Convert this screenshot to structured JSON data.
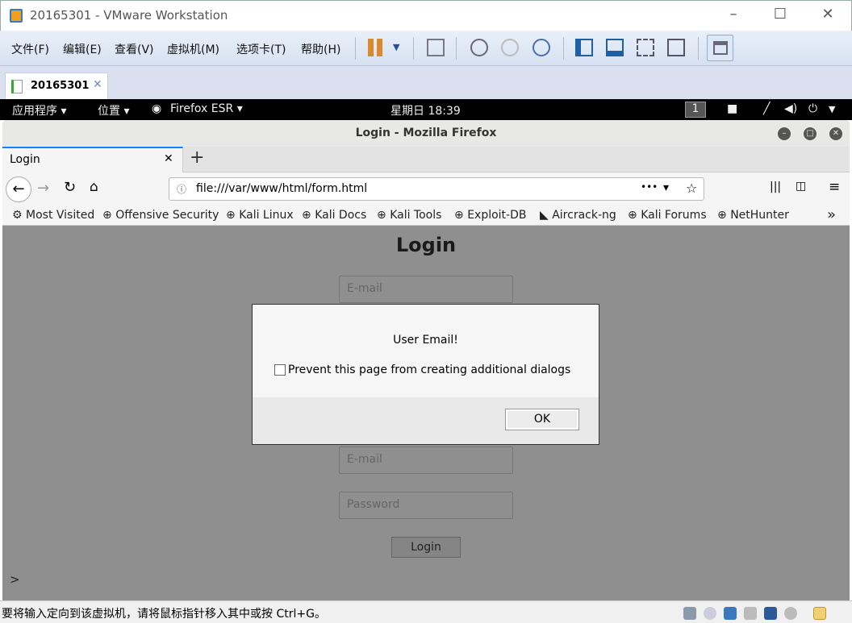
{
  "window": {
    "title": "20165301 - VMware Workstation",
    "minimize": "–",
    "maximize": "☐",
    "close": "✕"
  },
  "menu": [
    "文件(F)",
    "编辑(E)",
    "查看(V)",
    "虚拟机(M)",
    "选项卡(T)",
    "帮助(H)"
  ],
  "vm_tab": {
    "label": "20165301",
    "close": "✕"
  },
  "kali_panel": {
    "apps": "应用程序 ▾",
    "places": "位置 ▾",
    "firefox": "Firefox ESR ▾",
    "clock": "星期日 18:39",
    "workspace": "1"
  },
  "firefox": {
    "title": "Login - Mozilla Firefox",
    "tab": "Login",
    "tab_close": "✕",
    "new_tab": "+",
    "url": "file:///var/www/html/form.html",
    "more": "•••",
    "bookmarks": [
      "Most Visited",
      "Offensive Security",
      "Kali Linux",
      "Kali Docs",
      "Kali Tools",
      "Exploit-DB",
      "Aircrack-ng",
      "Kali Forums",
      "NetHunter"
    ],
    "overflow": "»"
  },
  "page": {
    "heading": "Login",
    "email_placeholder": "E-mail",
    "password_placeholder": "Password",
    "login_button": "Login",
    "prompt": ">"
  },
  "dialog": {
    "message": "User Email!",
    "checkbox_label": "Prevent this page from creating additional dialogs",
    "checked": false,
    "ok": "OK"
  },
  "status": {
    "message": "要将输入定向到该虚拟机，请将鼠标指针移入其中或按 Ctrl+G。"
  }
}
